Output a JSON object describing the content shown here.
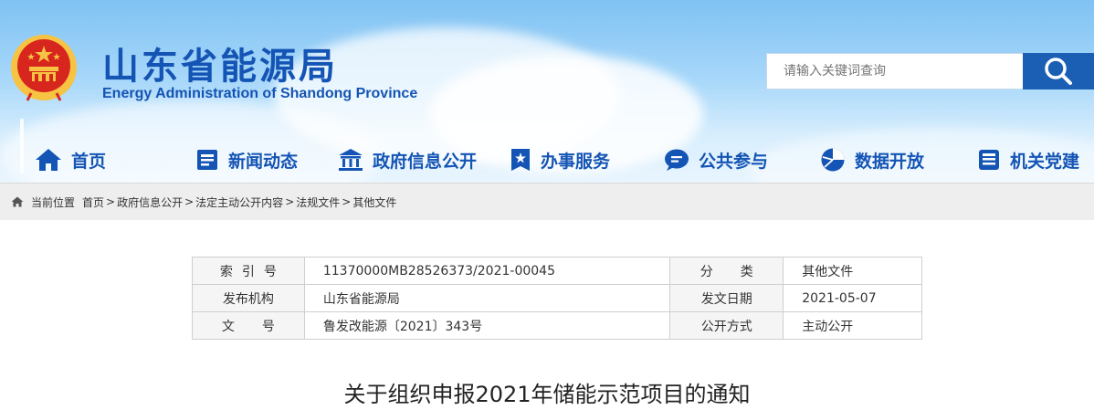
{
  "site": {
    "title_cn": "山东省能源局",
    "title_en": "Energy Administration of Shandong Province"
  },
  "search": {
    "placeholder": "请输入关键词查询"
  },
  "nav": {
    "items": [
      {
        "label": "首页",
        "icon": "home-icon"
      },
      {
        "label": "新闻动态",
        "icon": "news-icon"
      },
      {
        "label": "政府信息公开",
        "icon": "government-building-icon"
      },
      {
        "label": "办事服务",
        "icon": "service-badge-icon"
      },
      {
        "label": "公共参与",
        "icon": "chat-bubble-icon"
      },
      {
        "label": "数据开放",
        "icon": "pie-chart-icon"
      },
      {
        "label": "机关党建",
        "icon": "party-book-icon"
      }
    ]
  },
  "breadcrumb": {
    "prefix": "当前位置",
    "items": [
      "首页",
      "政府信息公开",
      "法定主动公开内容",
      "法规文件",
      "其他文件"
    ],
    "separator": ">"
  },
  "info": {
    "index_label": "索引号",
    "index_value": "11370000MB28526373/2021-00045",
    "category_label": "分类",
    "category_value": "其他文件",
    "publisher_label": "发布机构",
    "publisher_value": "山东省能源局",
    "date_label": "发文日期",
    "date_value": "2021-05-07",
    "docno_label": "文号",
    "docno_value": "鲁发改能源〔2021〕343号",
    "disclosure_label": "公开方式",
    "disclosure_value": "主动公开"
  },
  "article": {
    "title": "关于组织申报2021年储能示范项目的通知"
  },
  "colors": {
    "brand_blue": "#1454b4",
    "search_button": "#1a5fb4",
    "emblem_red": "#d7261e",
    "emblem_gold": "#f6c342"
  }
}
